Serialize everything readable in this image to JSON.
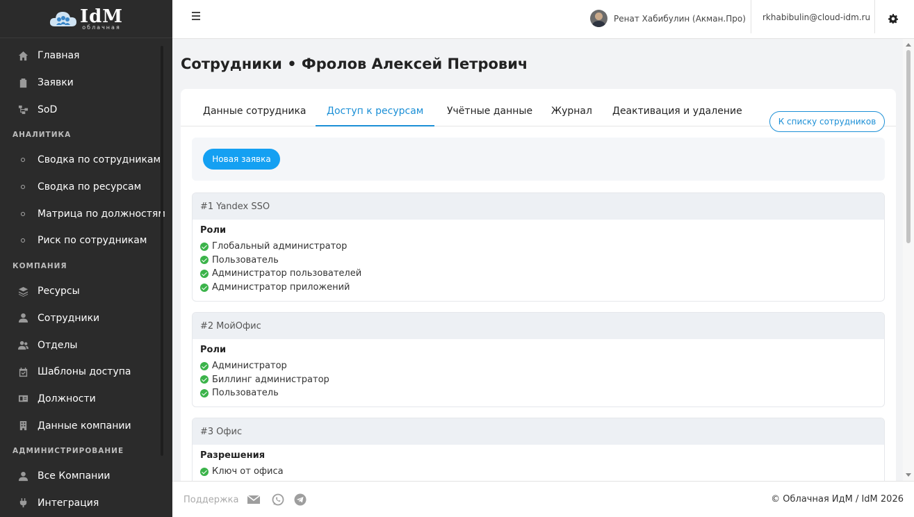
{
  "logo": {
    "main": "IdM",
    "sub": "облачная"
  },
  "sidebar": {
    "items": [
      {
        "label": "Главная",
        "icon": "home-icon"
      },
      {
        "label": "Заявки",
        "icon": "clipboard-icon"
      },
      {
        "label": "SoD",
        "icon": "sitemap-icon"
      }
    ],
    "sections": [
      {
        "title": "АНАЛИТИКА",
        "items": [
          {
            "label": "Сводка по сотрудникам"
          },
          {
            "label": "Сводка по ресурсам"
          },
          {
            "label": "Матрица по должностям"
          },
          {
            "label": "Риск по сотрудникам"
          }
        ]
      },
      {
        "title": "КОМПАНИЯ",
        "items": [
          {
            "label": "Ресурсы",
            "icon": "layers-icon"
          },
          {
            "label": "Сотрудники",
            "icon": "user-icon"
          },
          {
            "label": "Отделы",
            "icon": "users-icon"
          },
          {
            "label": "Шаблоны доступа",
            "icon": "calendar-check-icon"
          },
          {
            "label": "Должности",
            "icon": "id-card-icon"
          },
          {
            "label": "Данные компании",
            "icon": "building-icon"
          }
        ]
      },
      {
        "title": "АДМИНИСТРИРОВАНИЕ",
        "items": [
          {
            "label": "Все Компании",
            "icon": "user-icon"
          },
          {
            "label": "Интеграция",
            "icon": "plug-icon"
          }
        ]
      }
    ]
  },
  "header": {
    "user_name": "Ренат Хабибулин (Акман.Про)",
    "email": "rkhabibulin@cloud-idm.ru"
  },
  "page": {
    "title": "Сотрудники • Фролов Алексей Петрович",
    "tabs": [
      {
        "label": "Данные сотрудника",
        "active": false
      },
      {
        "label": "Доступ к ресурсам",
        "active": true
      },
      {
        "label": "Учётные данные",
        "active": false
      },
      {
        "label": "Журнал",
        "active": false
      },
      {
        "label": "Деактивация и удаление",
        "active": false
      }
    ],
    "back_button": "К списку сотрудников",
    "new_request_button": "Новая заявка",
    "resources": [
      {
        "num": "#1",
        "name": "Yandex SSO",
        "group": "Роли",
        "items": [
          "Глобальный администратор",
          "Пользователь",
          "Администратор пользователей",
          "Администратор приложений"
        ]
      },
      {
        "num": "#2",
        "name": "МойОфис",
        "group": "Роли",
        "items": [
          "Администратор",
          "Биллинг администратор",
          "Пользователь"
        ]
      },
      {
        "num": "#3",
        "name": "Офис",
        "group": "Разрешения",
        "items": [
          "Ключ от офиса"
        ]
      }
    ]
  },
  "footer": {
    "support": "Поддержка",
    "copyright": "© Облачная ИдМ / IdM 2026"
  },
  "colors": {
    "accent": "#1b8fd6",
    "button": "#14a0f2",
    "sidebar": "#2b2b2b",
    "check": "#3bb34a"
  }
}
